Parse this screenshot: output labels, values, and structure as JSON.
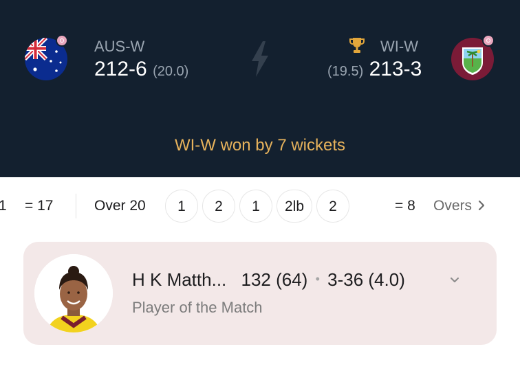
{
  "match": {
    "team1": {
      "name": "AUS-W",
      "score": "212-6",
      "overs": "(20.0)"
    },
    "team2": {
      "name": "WI-W",
      "score": "213-3",
      "overs": "(19.5)",
      "winner": true
    },
    "result": "WI-W won by 7 wickets"
  },
  "overs_strip": {
    "prev_first": "1",
    "prev_total": "= 17",
    "over_label": "Over 20",
    "balls": [
      "1",
      "2",
      "1",
      "2lb",
      "2"
    ],
    "total": "= 8",
    "overs_link": "Overs"
  },
  "potm": {
    "name": "H K Matth...",
    "batting": "132 (64)",
    "separator": "•",
    "bowling": "3-36 (4.0)",
    "label": "Player of the Match"
  },
  "colors": {
    "header_bg": "#13202f",
    "result_text": "#e6b25c",
    "card_bg": "#f3e8e8"
  },
  "icons": [
    "australia-flag-icon",
    "west-indies-flag-icon",
    "womens-badge-icon",
    "lightning-bolt-icon",
    "trophy-icon",
    "chevron-right-icon",
    "chevron-down-icon"
  ]
}
